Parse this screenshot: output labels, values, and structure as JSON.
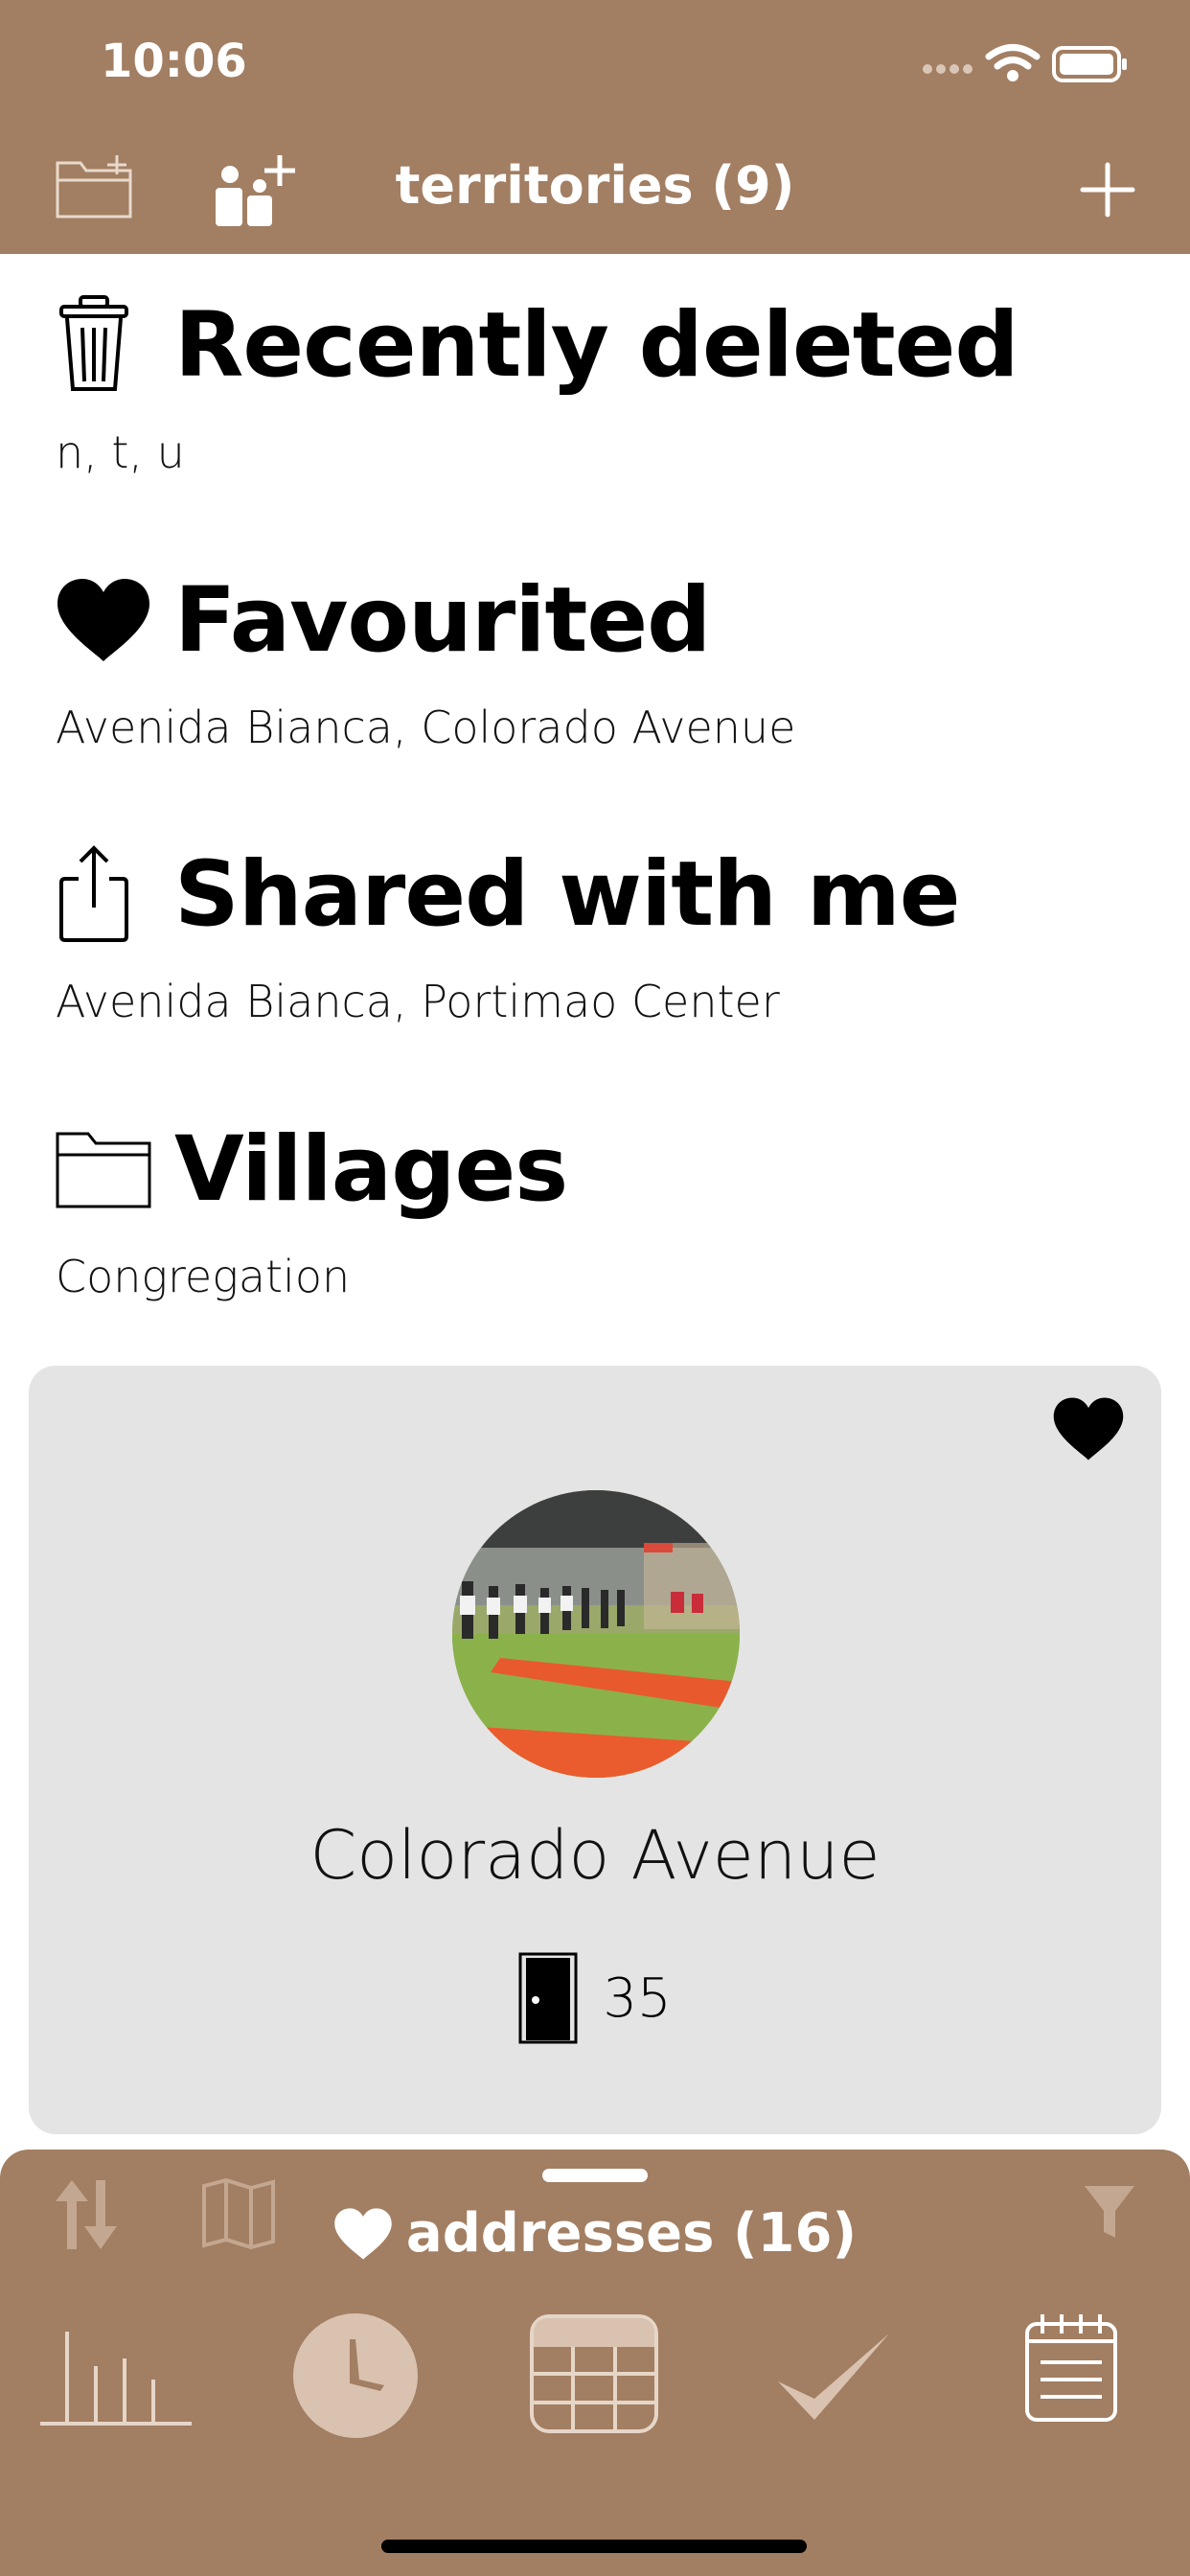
{
  "status_bar": {
    "time": "10:06"
  },
  "nav": {
    "title": "territories (9)"
  },
  "sections": [
    {
      "title": "Recently deleted",
      "subtitle": "n,  t,  u"
    },
    {
      "title": "Favourited",
      "subtitle": "Avenida Bianca,  Colorado Avenue"
    },
    {
      "title": "Shared with me",
      "subtitle": "Avenida Bianca,  Portimao Center"
    },
    {
      "title": "Villages",
      "subtitle": "Congregation"
    }
  ],
  "card": {
    "name": "Colorado Avenue",
    "count": "35",
    "favourited": true
  },
  "bottom_panel": {
    "title": "addresses (16)"
  },
  "colors": {
    "brand": "#a27e62",
    "card_bg": "#e4e4e4"
  }
}
